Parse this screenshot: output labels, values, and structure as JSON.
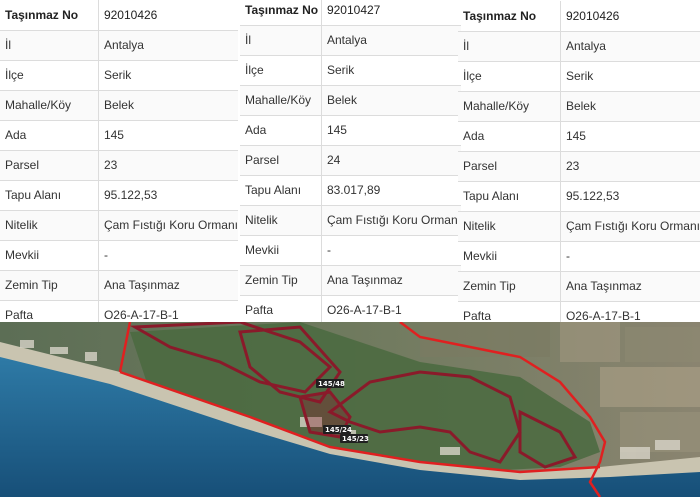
{
  "tables": [
    {
      "rows": [
        {
          "key": "Taşınmaz No",
          "value": "92010426"
        },
        {
          "key": "İl",
          "value": "Antalya"
        },
        {
          "key": "İlçe",
          "value": "Serik"
        },
        {
          "key": "Mahalle/Köy",
          "value": "Belek"
        },
        {
          "key": "Ada",
          "value": "145"
        },
        {
          "key": "Parsel",
          "value": "23"
        },
        {
          "key": "Tapu Alanı",
          "value": "95.122,53"
        },
        {
          "key": "Nitelik",
          "value": "Çam Fıstığı Koru Ormanı"
        },
        {
          "key": "Mevkii",
          "value": "-"
        },
        {
          "key": "Zemin Tip",
          "value": "Ana Taşınmaz"
        },
        {
          "key": "Pafta",
          "value": "O26-A-17-B-1"
        }
      ]
    },
    {
      "rows": [
        {
          "key": "Taşınmaz No",
          "value": "92010427"
        },
        {
          "key": "İl",
          "value": "Antalya"
        },
        {
          "key": "İlçe",
          "value": "Serik"
        },
        {
          "key": "Mahalle/Köy",
          "value": "Belek"
        },
        {
          "key": "Ada",
          "value": "145"
        },
        {
          "key": "Parsel",
          "value": "24"
        },
        {
          "key": "Tapu Alanı",
          "value": "83.017,89"
        },
        {
          "key": "Nitelik",
          "value": "Çam Fıstığı Koru Ormanı"
        },
        {
          "key": "Mevkii",
          "value": "-"
        },
        {
          "key": "Zemin Tip",
          "value": "Ana Taşınmaz"
        },
        {
          "key": "Pafta",
          "value": "O26-A-17-B-1"
        }
      ]
    },
    {
      "rows": [
        {
          "key": "Taşınmaz No",
          "value": "92010426"
        },
        {
          "key": "İl",
          "value": "Antalya"
        },
        {
          "key": "İlçe",
          "value": "Serik"
        },
        {
          "key": "Mahalle/Köy",
          "value": "Belek"
        },
        {
          "key": "Ada",
          "value": "145"
        },
        {
          "key": "Parsel",
          "value": "23"
        },
        {
          "key": "Tapu Alanı",
          "value": "95.122,53"
        },
        {
          "key": "Nitelik",
          "value": "Çam Fıstığı Koru Ormanı"
        },
        {
          "key": "Mevkii",
          "value": "-"
        },
        {
          "key": "Zemin Tip",
          "value": "Ana Taşınmaz"
        },
        {
          "key": "Pafta",
          "value": "O26-A-17-B-1"
        }
      ]
    }
  ],
  "map": {
    "labels": [
      "145/48",
      "145/24",
      "145/23"
    ],
    "colors": {
      "boundary": "#e02020",
      "parcel": "#8a1a2a",
      "sea": "#1d5f8c",
      "forest": "#4f6b45"
    }
  }
}
